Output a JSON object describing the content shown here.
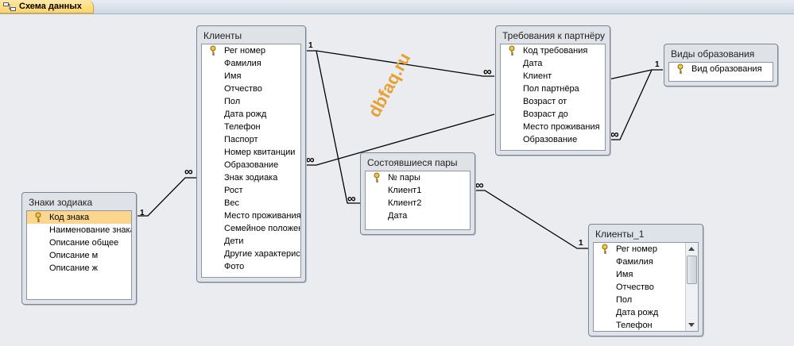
{
  "tab": {
    "label": "Схема данных",
    "icon": "relationships-icon"
  },
  "watermark": "dbfaq.ru",
  "tables": {
    "zodiac": {
      "title": "Знаки зодиака",
      "fields": [
        "Код знака",
        "Наименование знака",
        "Описание общее",
        "Описание м",
        "Описание ж"
      ],
      "key_field": "Код знака",
      "selected_field": "Код знака"
    },
    "clients": {
      "title": "Клиенты",
      "fields": [
        "Рег номер",
        "Фамилия",
        "Имя",
        "Отчество",
        "Пол",
        "Дата рожд",
        "Телефон",
        "Паспорт",
        "Номер квитанции",
        "Образование",
        "Знак зодиака",
        "Рост",
        "Вес",
        "Место проживания",
        "Семейное положение",
        "Дети",
        "Другие характеристики",
        "Фото"
      ],
      "key_field": "Рег номер"
    },
    "requirements": {
      "title": "Требования к партнёру",
      "fields": [
        "Код требования",
        "Дата",
        "Клиент",
        "Пол партнёра",
        "Возраст от",
        "Возраст до",
        "Место проживания",
        "Образование"
      ],
      "key_field": "Код требования"
    },
    "education": {
      "title": "Виды образования",
      "fields": [
        "Вид образования"
      ],
      "key_field": "Вид образования"
    },
    "couples": {
      "title": "Состоявшиеся пары",
      "fields": [
        "№ пары",
        "Клиент1",
        "Клиент2",
        "Дата"
      ],
      "key_field": "№ пары"
    },
    "clients1": {
      "title": "Клиенты_1",
      "fields": [
        "Рег номер",
        "Фамилия",
        "Имя",
        "Отчество",
        "Пол",
        "Дата рожд",
        "Телефон"
      ],
      "key_field": "Рег номер"
    }
  },
  "relationship_labels": {
    "one": "1",
    "many": "∞"
  },
  "colors": {
    "selected_row": "#fcd58f",
    "line": "#000000",
    "tab": "#ffd467"
  }
}
